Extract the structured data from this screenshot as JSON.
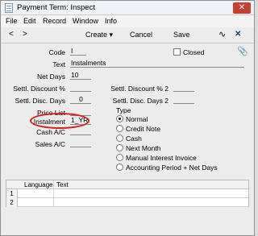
{
  "window": {
    "title": "Payment Term: Inspect",
    "close_glyph": "✕"
  },
  "menu": {
    "items": [
      "File",
      "Edit",
      "Record",
      "Window",
      "Info"
    ]
  },
  "toolbar": {
    "prev": "<",
    "next": ">",
    "create": "Create",
    "create_caret": "▾",
    "cancel": "Cancel",
    "save": "Save",
    "pulse_icon": "∿",
    "expand_icon": "✕",
    "attach_icon": "📎"
  },
  "form": {
    "code_label": "Code",
    "code_value": "I",
    "closed_label": "Closed",
    "text_label": "Text",
    "text_value": "Instalments",
    "net_days_label": "Net Days",
    "net_days_value": "10",
    "settl_discount_label": "Settl. Discount %",
    "settl_discount_value": "",
    "settl_discount2_label": "Settl. Discount % 2",
    "settl_discount2_value": "",
    "settl_days_label": "Settl. Disc. Days",
    "settl_days_value": "0",
    "settl_days2_label": "Settl. Disc. Days 2",
    "settl_days2_value": "",
    "price_list_label": "Price List",
    "price_list_value": "",
    "instalment_label": "Instalment",
    "instalment_value": "1_YR",
    "cash_ac_label": "Cash A/C",
    "cash_ac_value": "",
    "sales_ac_label": "Sales A/C",
    "sales_ac_value": ""
  },
  "type": {
    "label": "Type",
    "options": [
      "Normal",
      "Credit Note",
      "Cash",
      "Next Month",
      "Manual Interest Invoice",
      "Accounting Period + Net Days"
    ],
    "selected": "Normal"
  },
  "grid": {
    "headers": [
      "Language",
      "Text"
    ],
    "rows": [
      {
        "num": "1"
      },
      {
        "num": "2"
      }
    ]
  },
  "accent": {
    "highlight": "#d22020",
    "close": "#c84031"
  }
}
